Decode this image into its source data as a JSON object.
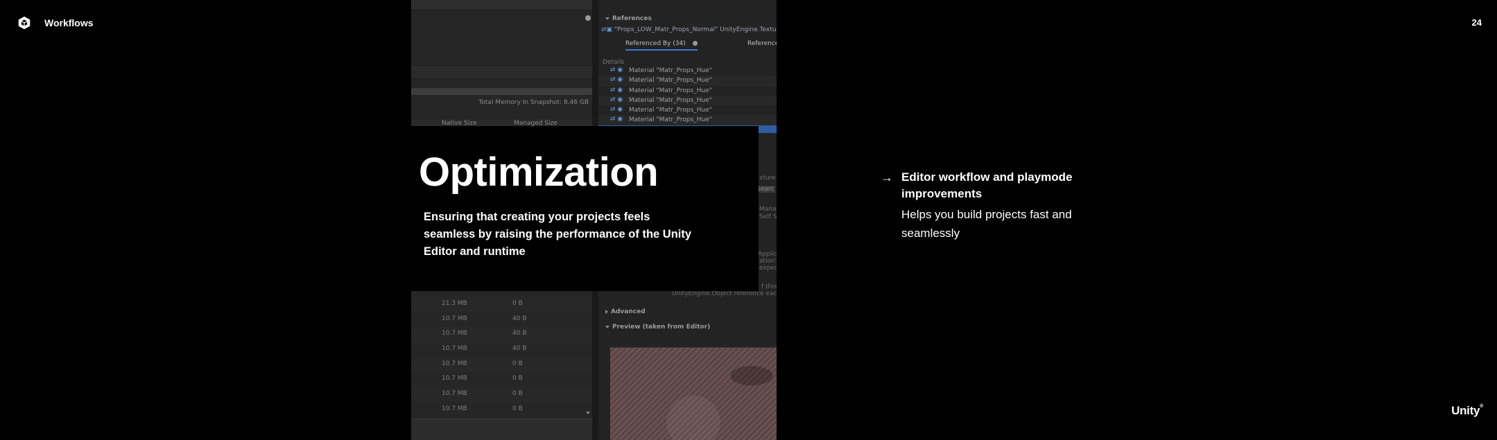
{
  "header": {
    "title": "Workflows",
    "logo_icon": "unity-cube-icon"
  },
  "page_number": "24",
  "brand": {
    "name": "Unity",
    "mark": "®"
  },
  "card": {
    "title": "Optimization",
    "description": "Ensuring that creating your projects feels seamless by raising the performance of the Unity Editor and runtime"
  },
  "bullet": {
    "icon": "arrow-right-icon",
    "heading": "Editor workflow and playmode improvements",
    "body": "Helps you build projects fast and seamlessly"
  },
  "profiler": {
    "total_memory": "Total Memory In Snapshot: 8.46 GB",
    "columns": {
      "native": "Native Size",
      "managed": "Managed Size"
    },
    "rows": [
      {
        "native": "21.3 MB",
        "managed": "0 B"
      },
      {
        "native": "10.7 MB",
        "managed": "40 B"
      },
      {
        "native": "10.7 MB",
        "managed": "40 B"
      },
      {
        "native": "10.7 MB",
        "managed": "40 B"
      },
      {
        "native": "10.7 MB",
        "managed": "0 B"
      },
      {
        "native": "10.7 MB",
        "managed": "0 B"
      },
      {
        "native": "10.7 MB",
        "managed": "0 B"
      },
      {
        "native": "10.7 MB",
        "managed": "0 B"
      }
    ],
    "references_header": "References",
    "reference_object": "\"Props_LOW_Matr_Props_Normal\" UnityEngine.Texture",
    "tab_referenced_by": "Referenced By (34)",
    "tab_references": "References",
    "details_label": "Details",
    "materials": [
      "Material \"Matr_Props_Hue\"",
      "Material \"Matr_Props_Hue\"",
      "Material \"Matr_Props_Hue\"",
      "Material \"Matr_Props_Hue\"",
      "Material \"Matr_Props_Hue\"",
      "Material \"Matr_Props_Hue\""
    ],
    "fragments": {
      "texture": "xture",
      "search": "Searc",
      "managed": "Mana",
      "self": "Self S",
      "applic": "Applic",
      "ation": "ation'",
      "expec": "expec",
      "of_this": "f this",
      "unity_ref": "UnityEngine.Object reference each ob"
    },
    "advanced_label": "Advanced",
    "preview_label": "Preview (taken from Editor)"
  }
}
